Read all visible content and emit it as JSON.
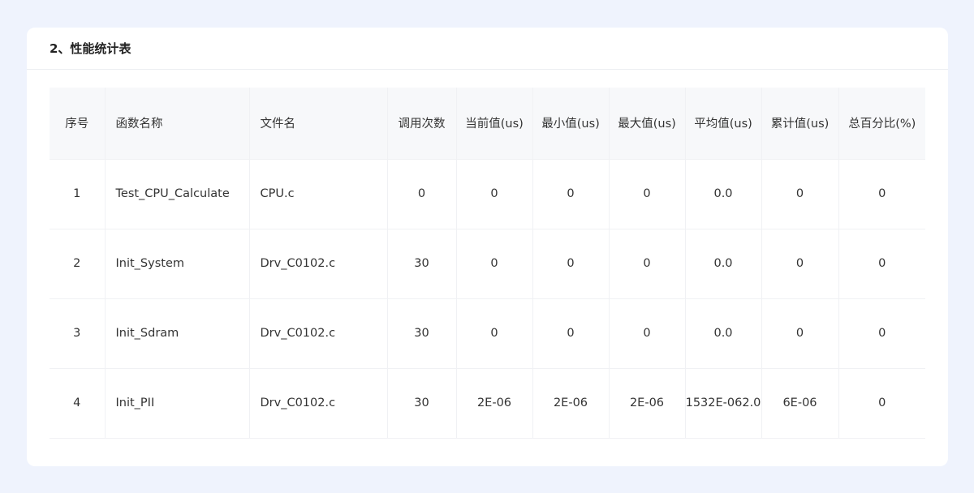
{
  "section": {
    "title": "2、性能统计表"
  },
  "table": {
    "columns": [
      "序号",
      "函数名称",
      "文件名",
      "调用次数",
      "当前值(us)",
      "最小值(us)",
      "最大值(us)",
      "平均值(us)",
      "累计值(us)",
      "总百分比(%)"
    ],
    "rows": [
      [
        "1",
        "Test_CPU_Calculate",
        "CPU.c",
        "0",
        "0",
        "0",
        "0",
        "0.0",
        "0",
        "0"
      ],
      [
        "2",
        "Init_System",
        "Drv_C0102.c",
        "30",
        "0",
        "0",
        "0",
        "0.0",
        "0",
        "0"
      ],
      [
        "3",
        "Init_Sdram",
        "Drv_C0102.c",
        "30",
        "0",
        "0",
        "0",
        "0.0",
        "0",
        "0"
      ],
      [
        "4",
        "Init_PII",
        "Drv_C0102.c",
        "30",
        "2E-06",
        "2E-06",
        "2E-06",
        "1532E-062.0",
        "6E-06",
        "0"
      ]
    ]
  }
}
